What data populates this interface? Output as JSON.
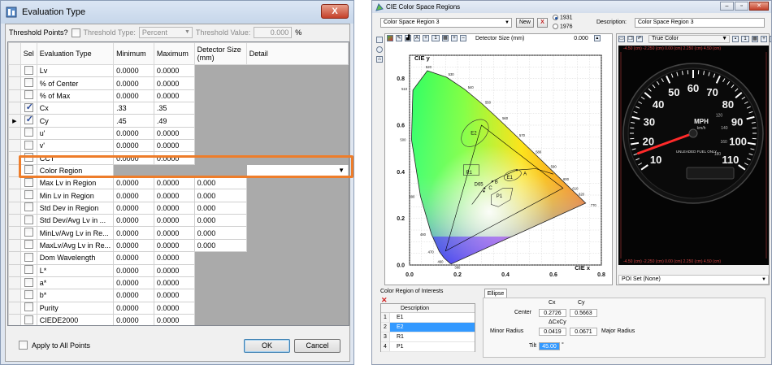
{
  "eval_window": {
    "title": "Evaluation Type",
    "close_label": "X",
    "threshold_points_label": "Threshold Points?",
    "threshold_type_label": "Threshold Type:",
    "threshold_type_value": "Percent",
    "threshold_value_label": "Threshold Value:",
    "threshold_value": "0.000",
    "threshold_unit": "%",
    "columns": [
      "Sel",
      "Evaluation Type",
      "Minimum",
      "Maximum",
      "Detector Size (mm)",
      "Detail"
    ],
    "rows": [
      {
        "name": "Lv",
        "min": "0.0000",
        "max": "0.0000",
        "det": "",
        "checked": false
      },
      {
        "name": "% of Center",
        "min": "0.0000",
        "max": "0.0000",
        "det": "",
        "checked": false
      },
      {
        "name": "% of Max",
        "min": "0.0000",
        "max": "0.0000",
        "det": "",
        "checked": false
      },
      {
        "name": "Cx",
        "min": ".33",
        "max": ".35",
        "det": "",
        "checked": true
      },
      {
        "name": "Cy",
        "min": ".45",
        "max": ".49",
        "det": "",
        "checked": true
      },
      {
        "name": "u'",
        "min": "0.0000",
        "max": "0.0000",
        "det": "",
        "checked": false
      },
      {
        "name": "v'",
        "min": "0.0000",
        "max": "0.0000",
        "det": "",
        "checked": false
      },
      {
        "name": "CCT",
        "min": "0.0000",
        "max": "0.0000",
        "det": "",
        "checked": false
      },
      {
        "name": "Color Region",
        "min": "",
        "max": "",
        "det": "",
        "checked": false
      },
      {
        "name": "Max Lv in Region",
        "min": "0.0000",
        "max": "0.0000",
        "det": "0.000",
        "checked": false
      },
      {
        "name": "Min Lv in Region",
        "min": "0.0000",
        "max": "0.0000",
        "det": "0.000",
        "checked": false
      },
      {
        "name": "Std Dev in Region",
        "min": "0.0000",
        "max": "0.0000",
        "det": "0.000",
        "checked": false
      },
      {
        "name": "Std Dev/Avg Lv in ...",
        "min": "0.0000",
        "max": "0.0000",
        "det": "0.000",
        "checked": false
      },
      {
        "name": "MinLv/Avg Lv in Re...",
        "min": "0.0000",
        "max": "0.0000",
        "det": "0.000",
        "checked": false
      },
      {
        "name": "MaxLv/Avg Lv in Re...",
        "min": "0.0000",
        "max": "0.0000",
        "det": "0.000",
        "checked": false
      },
      {
        "name": "Dom Wavelength",
        "min": "0.0000",
        "max": "0.0000",
        "det": "",
        "checked": false
      },
      {
        "name": "L*",
        "min": "0.0000",
        "max": "0.0000",
        "det": "",
        "checked": false
      },
      {
        "name": "a*",
        "min": "0.0000",
        "max": "0.0000",
        "det": "",
        "checked": false
      },
      {
        "name": "b*",
        "min": "0.0000",
        "max": "0.0000",
        "det": "",
        "checked": false
      },
      {
        "name": "Purity",
        "min": "0.0000",
        "max": "0.0000",
        "det": "",
        "checked": false
      },
      {
        "name": "CIEDE2000",
        "min": "0.0000",
        "max": "0.0000",
        "det": "",
        "checked": false
      }
    ],
    "apply_all_label": "Apply to All Points",
    "ok_label": "OK",
    "cancel_label": "Cancel",
    "highlight_color": "#ee7d2a"
  },
  "cie_window": {
    "title": "CIE Color Space Regions",
    "region_select": "Color Space Region 3",
    "new_label": "New",
    "delete_label": "X",
    "std_1931": "1931",
    "std_1976": "1976",
    "description_label": "Description:",
    "description_value": "Color Space Region 3",
    "detector_label": "Detector Size (mm)",
    "detector_value": "0.000",
    "chart_ylabel": "CIE y",
    "chart_xlabel": "CIE x",
    "x_ticks": [
      "0.0",
      "0.2",
      "0.4",
      "0.6",
      "0.8"
    ],
    "y_ticks": [
      "0.0",
      "0.2",
      "0.4",
      "0.6",
      "0.8"
    ],
    "wavelength_labels": [
      "520",
      "530",
      "510",
      "540",
      "550",
      "560",
      "500",
      "570",
      "580",
      "590",
      "600",
      "610",
      "620",
      "770",
      "490",
      "480",
      "470",
      "460",
      "380"
    ],
    "region_labels": [
      "E2",
      "R1",
      "E1",
      "A",
      "B",
      "D65",
      "C",
      "P1"
    ],
    "view_mode": "True Color",
    "gauge_numbers": [
      "10",
      "20",
      "30",
      "40",
      "50",
      "60",
      "70",
      "80",
      "90",
      "100",
      "110",
      "120",
      "140",
      "160",
      "180"
    ],
    "gauge_unit": "MPH",
    "gauge_sub": "km/h",
    "gauge_note": "UNLEADED FUEL ONLY",
    "scale_text": "-4.50 (cm) -2.250 (cm) 0.00 (cm) 2.250 (cm) 4.50 (cm)",
    "poi_label": "POI Set",
    "poi_value": "(None)",
    "roi_header": "Color Region of Interests",
    "roi_desc_col": "Description",
    "roi_items": [
      {
        "n": "1",
        "v": "E1",
        "sel": false
      },
      {
        "n": "2",
        "v": "E2",
        "sel": true
      },
      {
        "n": "3",
        "v": "R1",
        "sel": false
      },
      {
        "n": "4",
        "v": "P1",
        "sel": false
      }
    ],
    "ellipse_tab": "Ellipse",
    "col_cx": "Cx",
    "col_cy": "Cy",
    "center_label": "Center",
    "center_cx": "0.2726",
    "center_cy": "0.5663",
    "delta_label": "ΔCxCy",
    "minor_label": "Minor Radius",
    "minor_value": "0.0419",
    "major_value": "0.0671",
    "major_label": "Major Radius",
    "tilt_label": "Tilt",
    "tilt_value": "45.00",
    "tilt_unit": "°"
  }
}
